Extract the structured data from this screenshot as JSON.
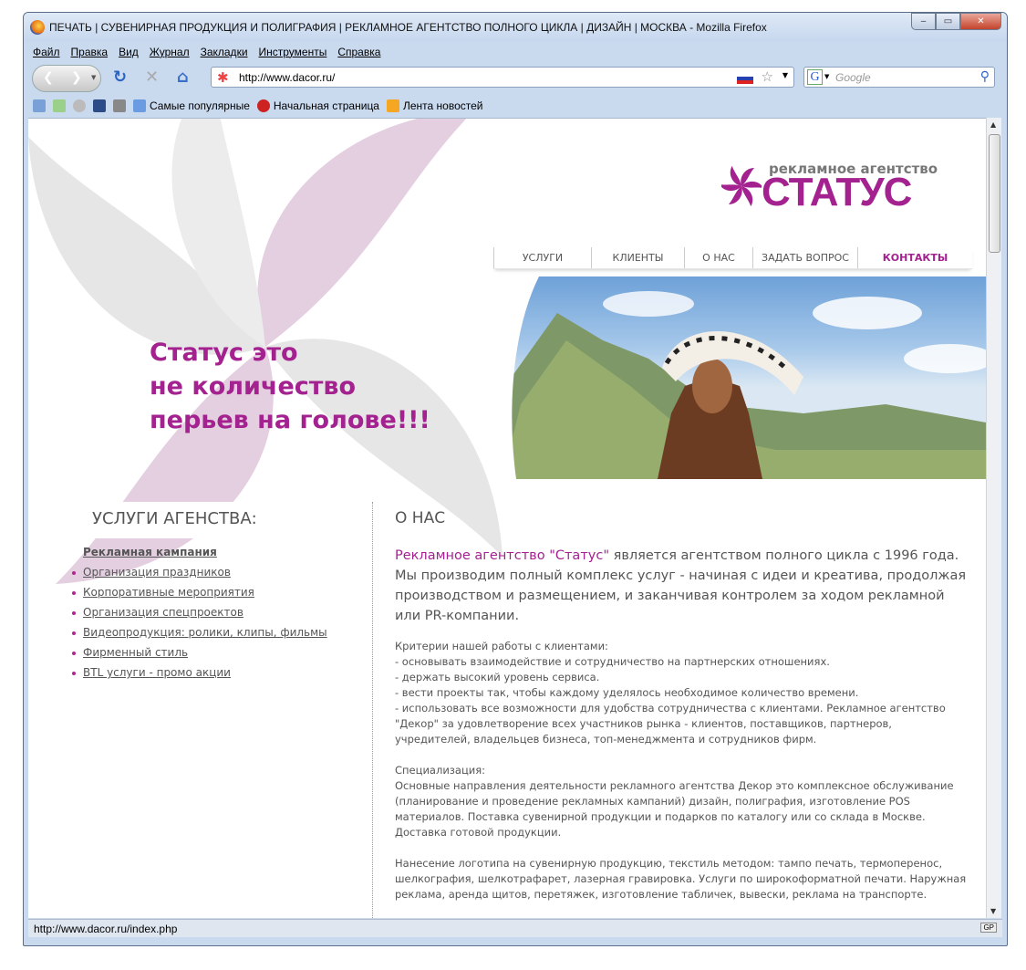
{
  "window": {
    "title": "ПЕЧАТЬ | СУВЕНИРНАЯ ПРОДУКЦИЯ И ПОЛИГРАФИЯ | РЕКЛАМНОЕ АГЕНТСТВО ПОЛНОГО ЦИКЛА | ДИЗАЙН | МОСКВА - Mozilla Firefox",
    "minimize": "‒",
    "maximize": "▭",
    "close": "✕"
  },
  "menu": [
    "Файл",
    "Правка",
    "Вид",
    "Журнал",
    "Закладки",
    "Инструменты",
    "Справка"
  ],
  "toolbar": {
    "url": "http://www.dacor.ru/",
    "search_placeholder": "Google"
  },
  "bookmarks": [
    "Самые популярные",
    "Начальная страница",
    "Лента новостей"
  ],
  "status": {
    "text": "http://www.dacor.ru/index.php",
    "badge": "GP"
  },
  "page": {
    "logo": {
      "tagline": "рекламное агентство",
      "name": "СТАТУС"
    },
    "nav": [
      "УСЛУГИ",
      "КЛИЕНТЫ",
      "О НАС",
      "ЗАДАТЬ ВОПРОС",
      "КОНТАКТЫ"
    ],
    "active_nav": "КОНТАКТЫ",
    "accent": "#a3228f",
    "slogan": [
      "Статус это",
      "не количество",
      "перьев на голове!!!"
    ],
    "services_title": "УСЛУГИ АГЕНСТВА:",
    "services": [
      "Рекламная кампания",
      "Организация праздников",
      "Корпоративные мероприятия",
      "Организация спецпроектов",
      "Видеопродукция: ролики, клипы, фильмы",
      "Фирменный стиль",
      "BTL услуги - промо акции"
    ],
    "about": {
      "title": "О НАС",
      "lead_highlight": "Рекламное агентство \"Статус\"",
      "lead_rest": " является агентством полного цикла с 1996 года. Мы производим полный комплекс услуг - начиная с идеи и креатива, продолжая производством и размещением, и заканчивая контролем за ходом рекламной или PR-компании.",
      "criteria": "Критерии нашей работы с клиентами:\n- основывать взаимодействие и сотрудничество на партнерских отношениях.\n- держать высокий уровень сервиса.\n- вести проекты так, чтобы каждому уделялось необходимое количество времени.\n- использовать все возможности для удобства сотрудничества с клиентами. Рекламное агентство \"Декор\" за удовлетворение всех участников рынка - клиентов, поставщиков, партнеров, учредителей, владельцев бизнеса, топ-менеджмента и сотрудников фирм.",
      "specialization": "Специализация:\nОсновные направления деятельности рекламного агентства Декор это комплексное обслуживание (планирование и проведение рекламных кампаний) дизайн, полиграфия, изготовление POS материалов. Поставка сувенирной продукции и подарков по каталогу или со склада в Москве. Доставка готовой продукции.",
      "logo_printing": "Нанесение логотипа на сувенирную продукцию, текстиль методом: тампо печать, термоперенос, шелкография, шелкотрафарет, лазерная гравировка. Услуги по широкоформатной печати. Наружная реклама, аренда щитов, перетяжек, изготовление табличек, вывески, реклама на транспорте."
    }
  }
}
